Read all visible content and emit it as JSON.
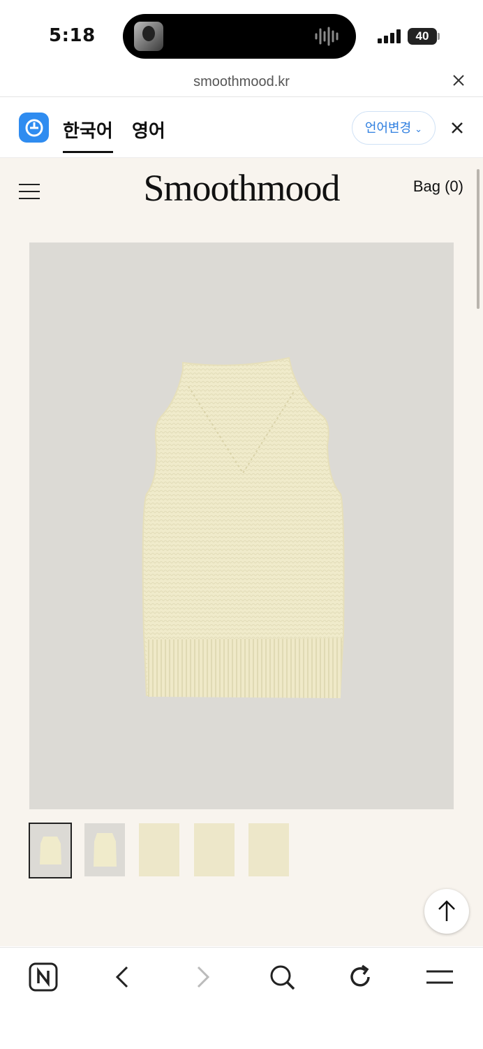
{
  "status": {
    "time": "5:18",
    "battery": "40"
  },
  "browser": {
    "url": "smoothmood.kr"
  },
  "translate": {
    "tabs": [
      "한국어",
      "영어"
    ],
    "change_button": "언어변경"
  },
  "site": {
    "brand": "Smoothmood",
    "bag": "Bag (0)"
  },
  "product": {
    "thumbnail_count": 5
  },
  "colors": {
    "accent": "#2f8cf0",
    "page_bg": "#f8f4ee",
    "image_bg": "#dcdad5",
    "knit": "#f0ebcb"
  },
  "icons": {
    "browser_bar": [
      "naver-n-icon",
      "back-icon",
      "forward-icon",
      "search-icon",
      "reload-icon",
      "menu-icon"
    ]
  }
}
